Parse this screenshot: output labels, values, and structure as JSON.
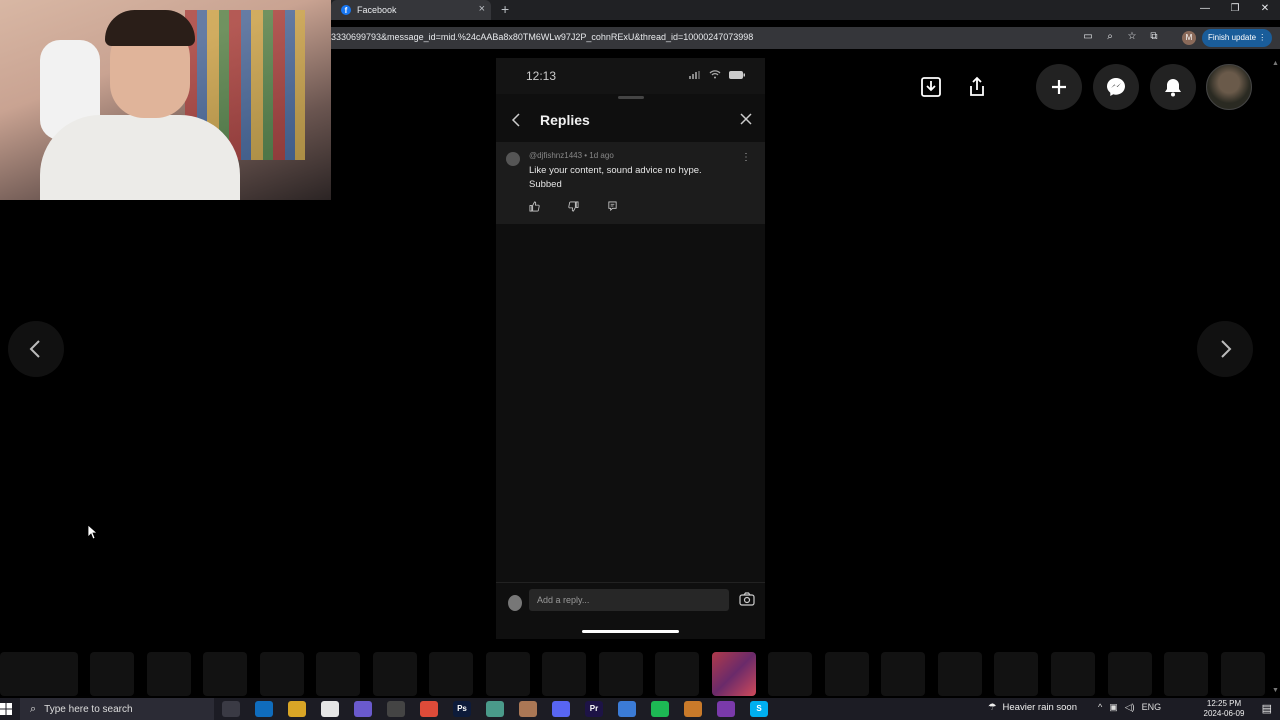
{
  "browser": {
    "tab_title": "Facebook",
    "tab_favicon": "f",
    "new_tab": "+",
    "url": "3330699793&message_id=mid.%24cAABa8x80TM6WLw97J2P_cohnRExU&thread_id=100002470739​98",
    "profile_initial": "M",
    "finish_update": "Finish update",
    "window_minimize": "—",
    "window_restore": "❐",
    "window_close": "✕",
    "menu_icon": "⋮"
  },
  "phone": {
    "time": "12:13",
    "header_title": "Replies",
    "comment": {
      "author": "@djfishnz1443",
      "age": "1d ago",
      "text": "Like your content, sound advice no hype. Subbed",
      "more": "⋮"
    },
    "reply_placeholder": "Add a reply..."
  },
  "taskbar": {
    "search_placeholder": "Type here to search",
    "weather": "Heavier rain soon",
    "lang": "ENG",
    "time": "12:25 PM",
    "date": "2024-06-09",
    "apps": [
      {
        "label": "",
        "color": "#3a3a44"
      },
      {
        "label": "",
        "color": "#0f6cbd"
      },
      {
        "label": "",
        "color": "#d9a526"
      },
      {
        "label": "",
        "color": "#e6e6e6"
      },
      {
        "label": "",
        "color": "#6a5acd"
      },
      {
        "label": "",
        "color": "#444"
      },
      {
        "label": "",
        "color": "#dd4b39"
      },
      {
        "label": "Ps",
        "color": "#0d1b3a"
      },
      {
        "label": "",
        "color": "#4a9a8a"
      },
      {
        "label": "",
        "color": "#aa7755"
      },
      {
        "label": "",
        "color": "#5865f2"
      },
      {
        "label": "Pr",
        "color": "#1d1346"
      },
      {
        "label": "",
        "color": "#3b7bd6"
      },
      {
        "label": "",
        "color": "#1db954"
      },
      {
        "label": "",
        "color": "#c97a2a"
      },
      {
        "label": "",
        "color": "#7a3aaa"
      },
      {
        "label": "S",
        "color": "#00aff0"
      }
    ]
  },
  "colors": {
    "accent": "#1a5d9a",
    "facebook": "#1877f2"
  }
}
